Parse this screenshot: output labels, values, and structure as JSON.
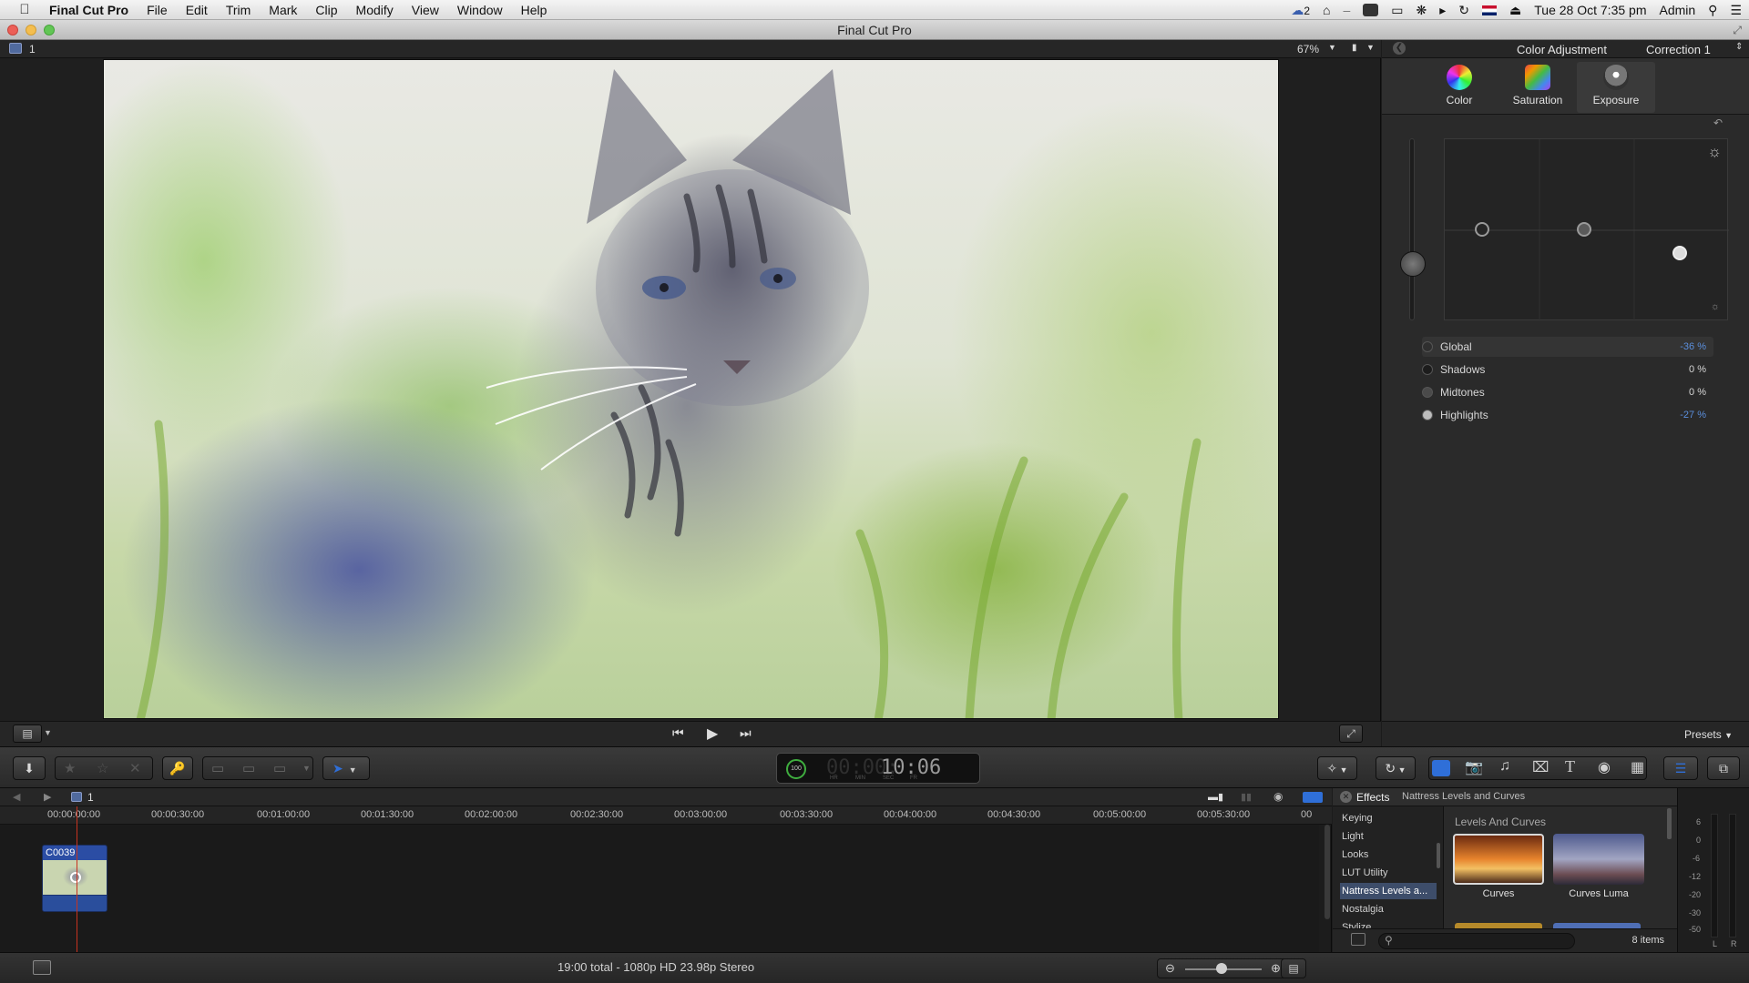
{
  "menubar": {
    "app_name": "Final Cut Pro",
    "items": [
      "File",
      "Edit",
      "Trim",
      "Mark",
      "Clip",
      "Modify",
      "View",
      "Window",
      "Help"
    ],
    "notification_count": "2",
    "clock": "Tue 28 Oct  7:35 pm",
    "user": "Admin"
  },
  "window": {
    "title": "Final Cut Pro"
  },
  "viewer": {
    "project_index": "1",
    "zoom": "67%"
  },
  "inspector": {
    "title": "Color Adjustment",
    "correction": "Correction 1",
    "tabs": [
      {
        "label": "Color"
      },
      {
        "label": "Saturation"
      },
      {
        "label": "Exposure"
      }
    ],
    "params": [
      {
        "label": "Global",
        "value": "-36 %",
        "value_color": "#5b8fdc"
      },
      {
        "label": "Shadows",
        "value": "0 %",
        "value_color": "#d6d6d6"
      },
      {
        "label": "Midtones",
        "value": "0 %",
        "value_color": "#d6d6d6"
      },
      {
        "label": "Highlights",
        "value": "-27 %",
        "value_color": "#5b8fdc"
      }
    ],
    "presets_label": "Presets"
  },
  "toolbar": {
    "timecode": {
      "scale": "100",
      "value": "10:06",
      "units": [
        "HR",
        "MIN",
        "SEC",
        "FR"
      ]
    }
  },
  "timeline": {
    "project_index": "1",
    "ruler": [
      "00:00:00:00",
      "00:00:30:00",
      "00:01:00:00",
      "00:01:30:00",
      "00:02:00:00",
      "00:02:30:00",
      "00:03:00:00",
      "00:03:30:00",
      "00:04:00:00",
      "00:04:30:00",
      "00:05:00:00",
      "00:05:30:00",
      "00"
    ],
    "clip_name": "C0039"
  },
  "effects": {
    "title": "Effects",
    "selected_path": "Nattress Levels and Curves",
    "categories": [
      "Keying",
      "Light",
      "Looks",
      "LUT Utility",
      "Nattress Levels a...",
      "Nostalgia",
      "Stylize"
    ],
    "selected_category_index": 4,
    "group_title": "Levels And Curves",
    "thumbnails": [
      {
        "label": "Curves"
      },
      {
        "label": "Curves Luma"
      }
    ],
    "item_count": "8 items"
  },
  "meters": {
    "scale": [
      "6",
      "0",
      "-6",
      "-12",
      "-20",
      "-30",
      "-50"
    ],
    "channels": [
      "L",
      "R"
    ]
  },
  "status": {
    "summary": "19:00 total - 1080p HD 23.98p Stereo"
  },
  "colors": {
    "accent": "#2f6fd8",
    "playhead": "#c7331f"
  }
}
